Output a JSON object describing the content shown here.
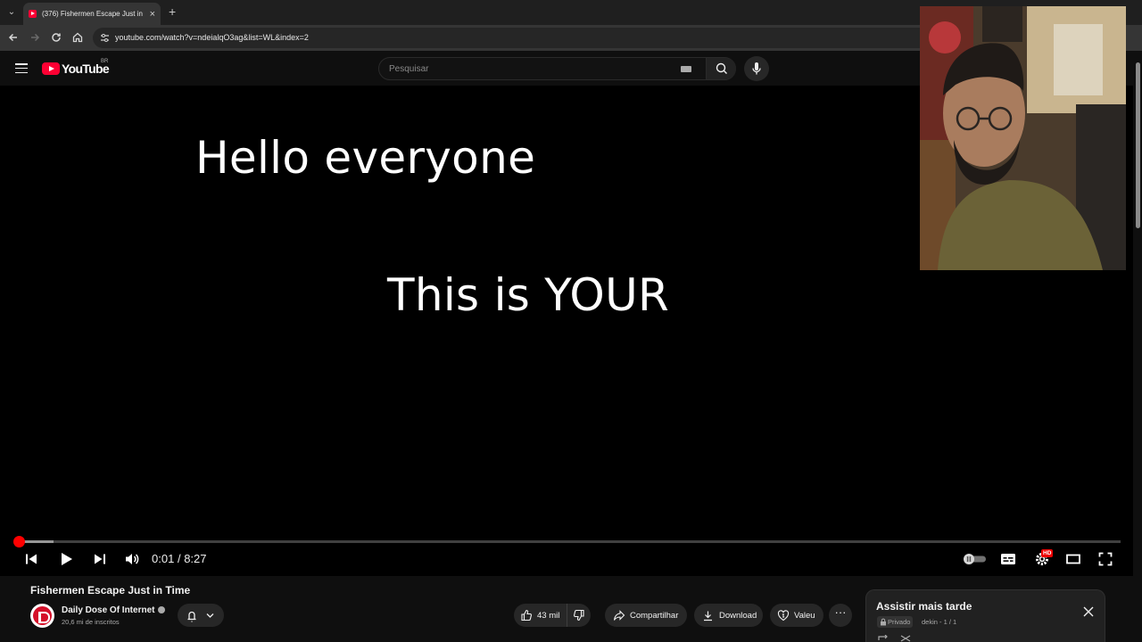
{
  "browser": {
    "tab_title": "(376) Fishermen Escape Just in Time",
    "tab_close": "×",
    "new_tab": "+",
    "url": "youtube.com/watch?v=ndeialqO3ag&list=WL&index=2"
  },
  "masthead": {
    "logo_text": "YouTube",
    "country_code": "BR",
    "search_placeholder": "Pesquisar"
  },
  "video": {
    "caption_line_1": "Hello everyone",
    "caption_line_2": "This is YOUR",
    "current_time": "0:01",
    "separator": "/",
    "duration": "8:27",
    "progress_fraction": 0.002,
    "buffered_fraction": 0.033,
    "hd_badge": "HD"
  },
  "details": {
    "title": "Fishermen Escape Just in Time",
    "channel_name": "Daily Dose Of Internet",
    "subscribers": "20,6 mi de inscritos",
    "likes": "43 mil",
    "share_label": "Compartilhar",
    "download_label": "Download",
    "thanks_label": "Valeu",
    "more_label": "···"
  },
  "playlist": {
    "title": "Assistir mais tarde",
    "privacy": "Privado",
    "meta": "dekin - 1 / 1"
  },
  "colors": {
    "accent_red": "#ff0000",
    "page_bg": "#0f0f0f",
    "pill_bg": "#272727"
  }
}
